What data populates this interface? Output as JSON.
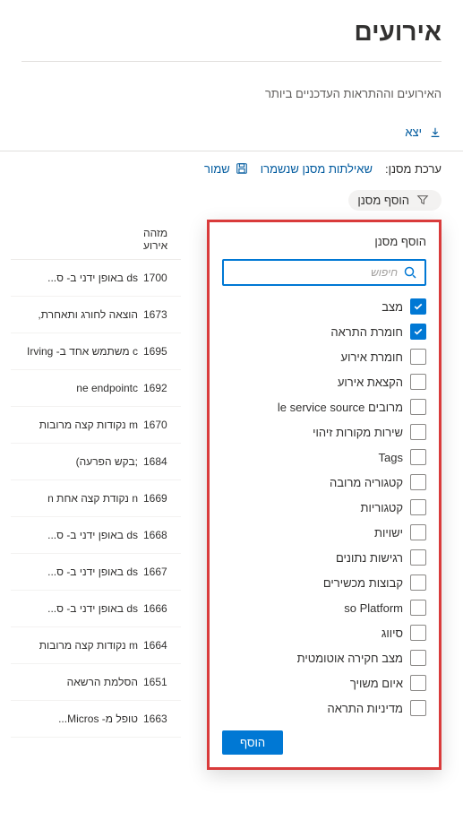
{
  "page": {
    "title": "אירועים",
    "subtitle": "האירועים וההתראות העדכניים ביותר"
  },
  "toolbar": {
    "export": "יצא"
  },
  "filterBar": {
    "prefix": "ערכת מסנן:",
    "savedQueries": "שאילתות מסנן שנשמרו",
    "save": "שמור"
  },
  "pill": {
    "addFilter": "הוסף מסנן"
  },
  "panel": {
    "title": "הוסף מסנן",
    "searchPlaceholder": "חיפוש",
    "searchValue": "",
    "addButton": "הוסף",
    "options": [
      {
        "label": "מצב",
        "checked": true
      },
      {
        "label": "חומרת התראה",
        "checked": true
      },
      {
        "label": "חומרת אירוע",
        "checked": false
      },
      {
        "label": "הקצאת אירוע",
        "checked": false
      },
      {
        "label": "מרובים le service source",
        "checked": false
      },
      {
        "label": "שירות   מקורות זיהוי",
        "checked": false
      },
      {
        "label": "Tags",
        "checked": false
      },
      {
        "label": "קטגוריה מרובה",
        "checked": false
      },
      {
        "label": "קטגוריות",
        "checked": false
      },
      {
        "label": "ישויות",
        "checked": false
      },
      {
        "label": "רגישות נתונים",
        "checked": false
      },
      {
        "label": "קבוצות מכשירים",
        "checked": false
      },
      {
        "label": "so Platform",
        "checked": false
      },
      {
        "label": "סיווג",
        "checked": false
      },
      {
        "label": "מצב חקירה אוטומטית",
        "checked": false
      },
      {
        "label": "איום משויך",
        "checked": false
      },
      {
        "label": "מדיניות התראה",
        "checked": false
      }
    ]
  },
  "table": {
    "idHeader": "מזהה אירוע",
    "rows": [
      {
        "id": "1700",
        "name": "ds באופן ידני ב- ס..."
      },
      {
        "id": "1673",
        "name": "הוצאה לחורג ותאחרת,"
      },
      {
        "id": "1695",
        "name": "c משתמש אחד ב- Irving"
      },
      {
        "id": "1692",
        "name": "ne endpointc"
      },
      {
        "id": "1670",
        "name": "m נקודות קצה מרובות"
      },
      {
        "id": "1684",
        "name": ";בקש הפרעה)"
      },
      {
        "id": "1669",
        "name": "n נקודת קצה אחת n"
      },
      {
        "id": "1668",
        "name": "ds באופן ידני ב- ס..."
      },
      {
        "id": "1667",
        "name": "ds באופן ידני ב- ס..."
      },
      {
        "id": "1666",
        "name": "ds באופן ידני ב- ס..."
      },
      {
        "id": "1664",
        "name": "m נקודות קצה מרובות"
      },
      {
        "id": "1651",
        "name": "הסלמת הרשאה"
      },
      {
        "id": "1663",
        "name": "טופל מ- Micros..."
      }
    ]
  }
}
